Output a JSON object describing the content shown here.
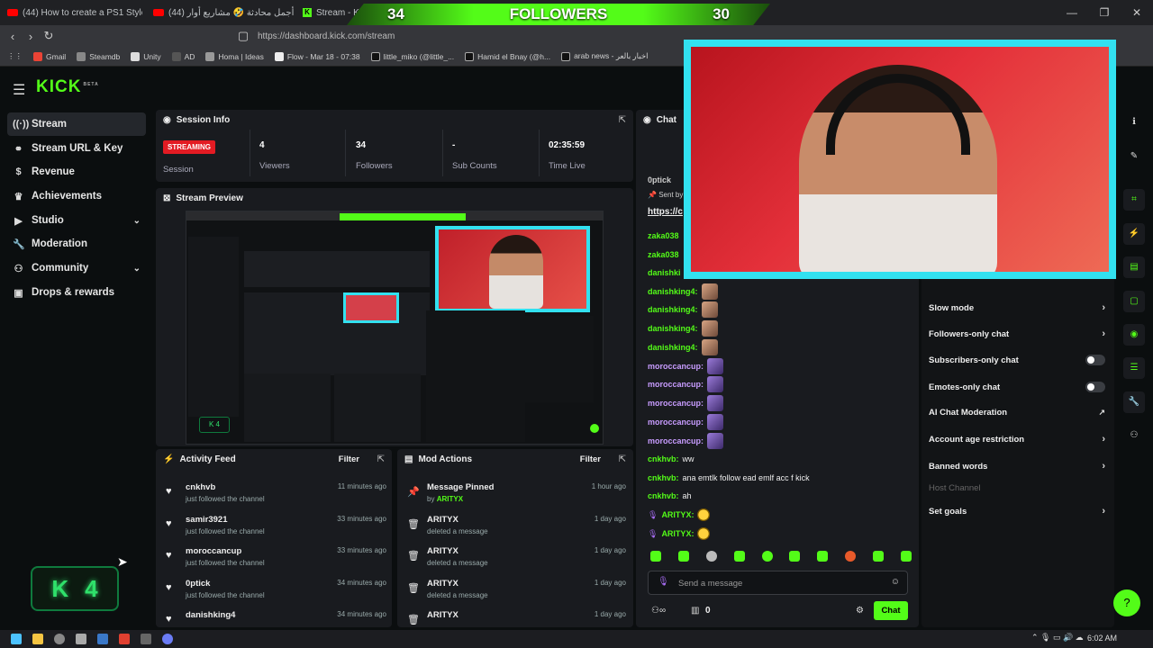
{
  "browser": {
    "tabs": [
      {
        "label": "(44) How to create a PS1 Style Horro",
        "icon": "youtube-icon"
      },
      {
        "label": "(44) أجمل محادثة 🤣 مشاريع أوار ...be",
        "icon": "youtube-icon"
      },
      {
        "label": "Stream - Ki",
        "icon": "kick-icon"
      }
    ],
    "url": "https://dashboard.kick.com/stream",
    "bookmarks": [
      "Gmail",
      "Steamdb",
      "Unity",
      "AD",
      "Homa | Ideas",
      "Flow - Mar 18 - 07:38",
      "little_miko (@little_...",
      "Hamid el Bnay (@h...",
      "arab news - اخبار بالعر"
    ]
  },
  "overlay": {
    "followers_label": "FOLLOWERS",
    "followers_left": "34",
    "followers_right": "30",
    "k4_letter": "K",
    "k4_number": "4"
  },
  "sidebar": {
    "items": [
      {
        "label": "Stream",
        "icon": "broadcast-icon"
      },
      {
        "label": "Stream URL & Key",
        "icon": "link-icon"
      },
      {
        "label": "Revenue",
        "icon": "dollar-icon"
      },
      {
        "label": "Achievements",
        "icon": "trophy-icon"
      },
      {
        "label": "Studio",
        "icon": "video-icon"
      },
      {
        "label": "Moderation",
        "icon": "wrench-icon"
      },
      {
        "label": "Community",
        "icon": "people-icon"
      },
      {
        "label": "Drops & rewards",
        "icon": "gift-icon"
      }
    ]
  },
  "session": {
    "title": "Session Info",
    "status": "STREAMING",
    "status_label": "Session",
    "viewers": "4",
    "viewers_label": "Viewers",
    "followers": "34",
    "followers_label": "Followers",
    "subs": "-",
    "subs_label": "Sub Counts",
    "time": "02:35:59",
    "time_label": "Time Live"
  },
  "preview": {
    "title": "Stream Preview"
  },
  "activity": {
    "title": "Activity Feed",
    "filter": "Filter",
    "rows": [
      {
        "name": "cnkhvb",
        "sub": "just followed the channel",
        "time": "11 minutes ago"
      },
      {
        "name": "samir3921",
        "sub": "just followed the channel",
        "time": "33 minutes ago"
      },
      {
        "name": "moroccancup",
        "sub": "just followed the channel",
        "time": "33 minutes ago"
      },
      {
        "name": "0ptick",
        "sub": "just followed the channel",
        "time": "34 minutes ago"
      },
      {
        "name": "danishking4",
        "sub": "",
        "time": "34 minutes ago"
      }
    ]
  },
  "mod": {
    "title": "Mod Actions",
    "filter": "Filter",
    "rows": [
      {
        "name": "Message Pinned",
        "sub_prefix": "by",
        "sub_user": "ARITYX",
        "time": "1 hour ago"
      },
      {
        "name": "ARITYX",
        "sub": "deleted a message",
        "time": "1 day ago"
      },
      {
        "name": "ARITYX",
        "sub": "deleted a message",
        "time": "1 day ago"
      },
      {
        "name": "ARITYX",
        "sub": "deleted a message",
        "time": "1 day ago"
      },
      {
        "name": "ARITYX",
        "sub": "",
        "time": "1 day ago"
      }
    ]
  },
  "chat": {
    "title": "Chat",
    "pinned_user": "0ptick",
    "sent_by": "Sent by",
    "pinned_link": "https://c",
    "messages": [
      {
        "user": "zaka038",
        "text": ""
      },
      {
        "user": "zaka038",
        "text": ""
      },
      {
        "user": "danishki",
        "text": ""
      },
      {
        "user": "danishking4:",
        "text": ""
      },
      {
        "user": "danishking4:",
        "text": ""
      },
      {
        "user": "danishking4:",
        "text": ""
      },
      {
        "user": "danishking4:",
        "text": ""
      },
      {
        "user": "moroccancup:",
        "text": ""
      },
      {
        "user": "moroccancup:",
        "text": ""
      },
      {
        "user": "moroccancup:",
        "text": ""
      },
      {
        "user": "moroccancup:",
        "text": ""
      },
      {
        "user": "moroccancup:",
        "text": ""
      },
      {
        "user": "cnkhvb:",
        "text": "ww"
      },
      {
        "user": "cnkhvb:",
        "text": "ana emtlk follow ead emlf acc f kick"
      },
      {
        "user": "cnkhvb:",
        "text": "ah"
      },
      {
        "user": "ARITYX:",
        "text": ""
      },
      {
        "user": "ARITYX:",
        "text": ""
      }
    ],
    "input_placeholder": "Send a message",
    "points": "0",
    "send_label": "Chat"
  },
  "chat_settings": {
    "items": [
      {
        "label": "Slow mode",
        "control": "chevron"
      },
      {
        "label": "Followers-only chat",
        "control": "chevron"
      },
      {
        "label": "Subscribers-only chat",
        "control": "toggle"
      },
      {
        "label": "Emotes-only chat",
        "control": "toggle"
      },
      {
        "label": "AI Chat Moderation",
        "control": "external"
      },
      {
        "label": "Account age restriction",
        "control": "chevron"
      },
      {
        "label": "Banned words",
        "control": "chevron"
      },
      {
        "label": "Host Channel",
        "control": "none"
      },
      {
        "label": "Set goals",
        "control": "chevron"
      }
    ]
  },
  "taskbar": {
    "time": "6:02 AM"
  },
  "colors": {
    "brand": "#53fc18",
    "streaming": "#e31b23",
    "cam_border": "#32e1f0"
  }
}
